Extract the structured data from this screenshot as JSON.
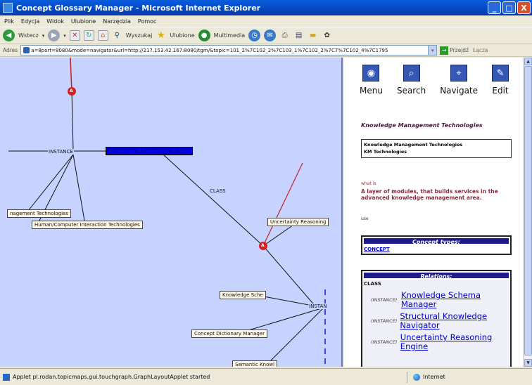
{
  "window": {
    "title": "Concept Glossary Manager - Microsoft Internet Explorer",
    "buttons": [
      "_",
      "□",
      "X"
    ]
  },
  "menubar": [
    "Plik",
    "Edycja",
    "Widok",
    "Ulubione",
    "Narzędzia",
    "Pomoc"
  ],
  "toolbar": {
    "back_label": "Wstecz",
    "search_label": "Wyszukaj",
    "favorites_label": "Ulubione",
    "media_label": "Multimedia"
  },
  "address": {
    "label": "Adres",
    "url": "a=8port=8080&mode=navigator&url=http://217.153.42.167:8080/tgm/&topic=101_2%7C102_2%7C103_1%7C102_2%7C7%7C102_4%7C1795",
    "go_label": "Przejdź",
    "links_label": "Łącza"
  },
  "graph": {
    "selected_node": "Knowledge Management Technologies",
    "nodes": [
      "nagement Technologies",
      "Human/Computer Interaction Technologies",
      "Uncertainty Reasoning",
      "Knowledge Sche",
      "Concept Dictionary Manager",
      "Semantic Knowl"
    ],
    "edge_labels": {
      "instance_top": "INSTANCE",
      "class": "CLASS",
      "instance_right": "INSTAN"
    },
    "marker_labels": [
      "A",
      "A"
    ]
  },
  "sidebar": {
    "nav": [
      {
        "label": "Menu",
        "icon": "globe-icon"
      },
      {
        "label": "Search",
        "icon": "magnifier-icon"
      },
      {
        "label": "Navigate",
        "icon": "map-icon"
      },
      {
        "label": "Edit",
        "icon": "pencil-icon"
      }
    ],
    "topic_title": "Knowledge Management Technologies",
    "names": [
      "Knowledge Management Technologies",
      "KM Technologies"
    ],
    "whatis_label": "what is",
    "description": "A layer of modules, that builds services in the advanced knowledge management area.",
    "tiny_label": "use",
    "concept_types": {
      "header": "Concept types:",
      "items": [
        "CONCEPT"
      ]
    },
    "relations": {
      "header": "Relations:",
      "type": "CLASS",
      "items": [
        {
          "role": "(INSTANCE)",
          "target": "Knowledge Schema Manager"
        },
        {
          "role": "(INSTANCE)",
          "target": "Structural Knowledge Navigator"
        },
        {
          "role": "(INSTANCE)",
          "target": "Uncertainty Reasoning Engine"
        }
      ]
    }
  },
  "status": {
    "message": "Applet pl.rodan.topicmaps.gui.touchgraph.GraphLayoutApplet started",
    "zone": "Internet"
  }
}
